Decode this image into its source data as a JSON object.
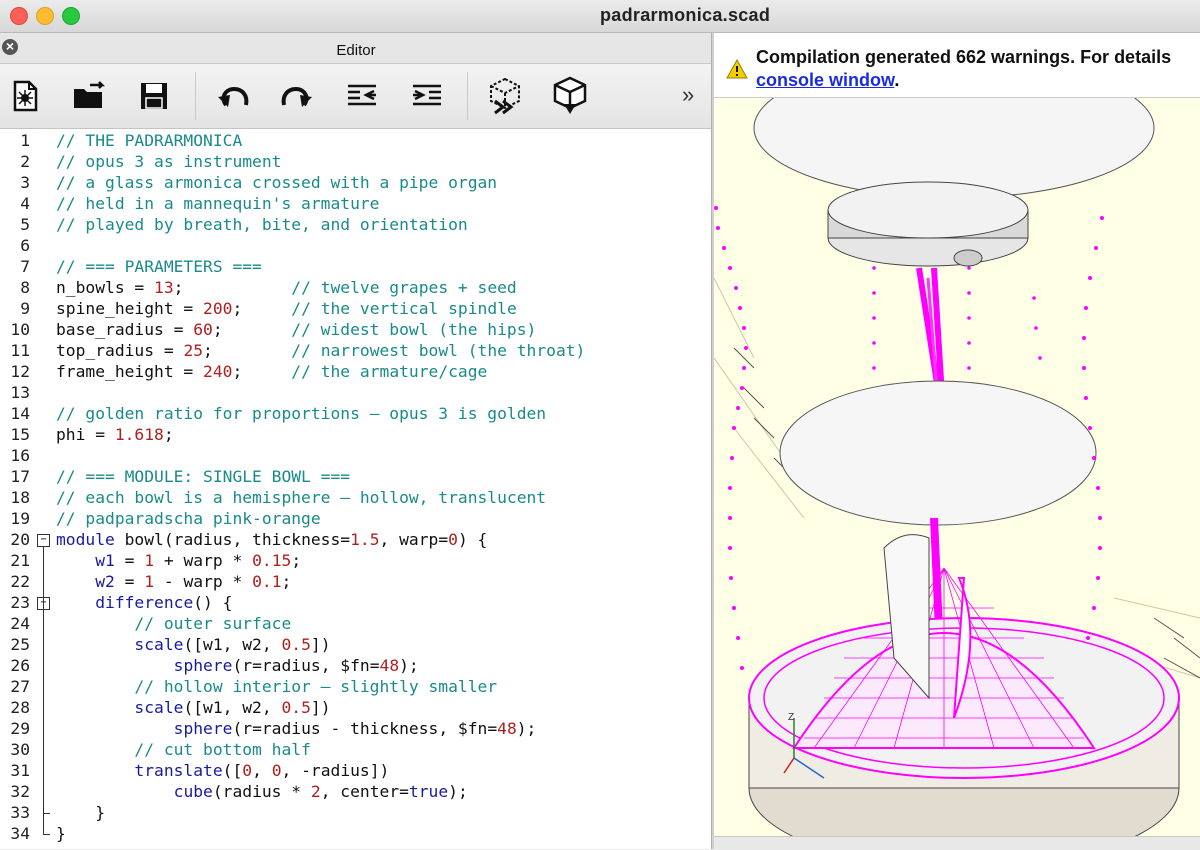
{
  "window": {
    "title": "padrarmonica.scad"
  },
  "editor": {
    "title": "Editor"
  },
  "toolbar": {
    "buttons": [
      {
        "name": "new-file-icon"
      },
      {
        "name": "open-folder-icon"
      },
      {
        "name": "save-icon"
      },
      {
        "name": "undo-icon"
      },
      {
        "name": "redo-icon"
      },
      {
        "name": "unindent-icon"
      },
      {
        "name": "indent-icon"
      },
      {
        "name": "preview-icon"
      },
      {
        "name": "render-icon"
      }
    ],
    "more": "»"
  },
  "console": {
    "warning_text": "Compilation generated 662 warnings. For details",
    "link_text": "console window",
    "suffix": "."
  },
  "code": {
    "lines": [
      "1",
      "2",
      "3",
      "4",
      "5",
      "6",
      "7",
      "8",
      "9",
      "10",
      "11",
      "12",
      "13",
      "14",
      "15",
      "16",
      "17",
      "18",
      "19",
      "20",
      "21",
      "22",
      "23",
      "24",
      "25",
      "26",
      "27",
      "28",
      "29",
      "30",
      "31",
      "32",
      "33",
      "34"
    ]
  },
  "colors": {
    "comment": "#1a8a8a",
    "keyword": "#1a1aa0",
    "number": "#b02020",
    "viewport_bg": "#ffffe5",
    "mesh": "#ff00ff"
  }
}
